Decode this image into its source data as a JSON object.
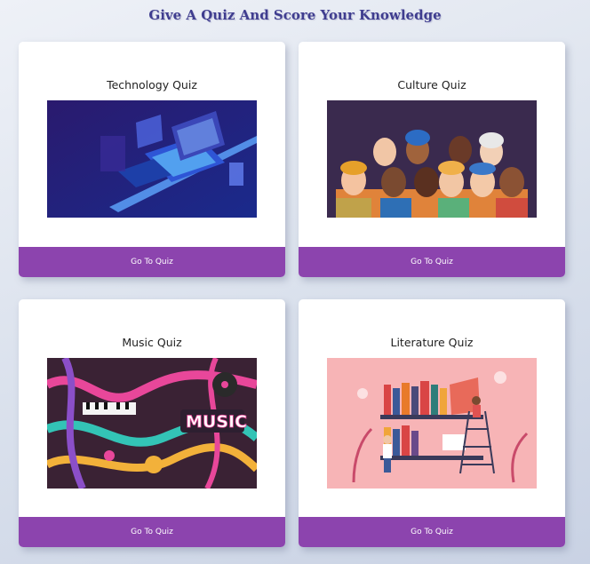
{
  "header": {
    "title": "Give A Quiz And Score Your Knowledge"
  },
  "quizzes": [
    {
      "title": "Technology Quiz",
      "button": "Go To Quiz",
      "image_icon": "technology-illustration"
    },
    {
      "title": "Culture Quiz",
      "button": "Go To Quiz",
      "image_icon": "culture-illustration"
    },
    {
      "title": "Music Quiz",
      "button": "Go To Quiz",
      "image_icon": "music-illustration"
    },
    {
      "title": "Literature Quiz",
      "button": "Go To Quiz",
      "image_icon": "literature-illustration"
    }
  ],
  "colors": {
    "accent": "#8c44ae",
    "title": "#3f3d8f"
  }
}
